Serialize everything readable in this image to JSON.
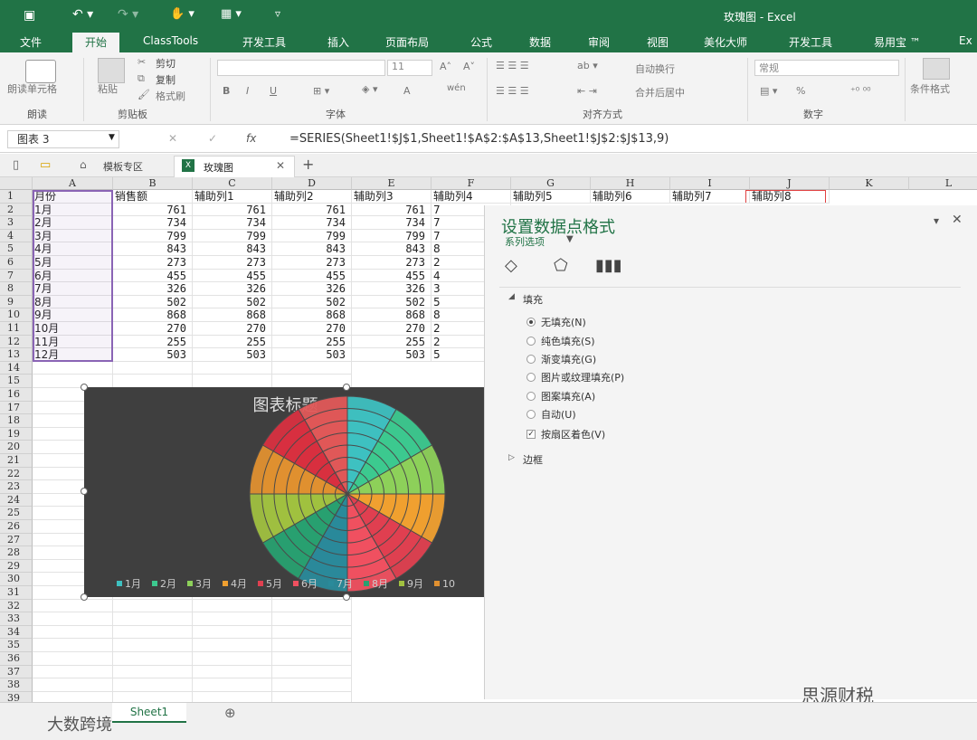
{
  "titlebar": {
    "title": "玫瑰图 - Excel"
  },
  "tabs": [
    "文件",
    "开始",
    "ClassTools",
    "开发工具",
    "插入",
    "页面布局",
    "公式",
    "数据",
    "审阅",
    "视图",
    "美化大师",
    "开发工具",
    "易用宝 ™",
    "Ex"
  ],
  "ribbon": {
    "read_cell": "朗读单元格",
    "paste": "粘贴",
    "cut": "剪切",
    "copy": "复制",
    "format_painter": "格式刷",
    "font_size": "11",
    "bold": "B",
    "italic": "I",
    "underline": "U",
    "font_color": "A",
    "wen": "wén",
    "wrap": "自动换行",
    "merge": "合并后居中",
    "number_format": "常规",
    "percent": "%",
    "cond_format": "条件格式",
    "groups": [
      "朗读",
      "剪贴板",
      "字体",
      "对齐方式",
      "数字"
    ]
  },
  "formula": {
    "name_box": "图表 3",
    "fx": "fx",
    "cancel": "✕",
    "enter": "✓",
    "content": "=SERIES(Sheet1!$J$1,Sheet1!$A$2:$A$13,Sheet1!$J$2:$J$13,9)"
  },
  "file_tabs": {
    "templates": "模板专区",
    "workbook": "玫瑰图",
    "close": "✕",
    "add": "+"
  },
  "columns": [
    "A",
    "B",
    "C",
    "D",
    "E",
    "F",
    "G",
    "H",
    "I",
    "J",
    "K",
    "L"
  ],
  "rows": [
    "1",
    "2",
    "3",
    "4",
    "5",
    "6",
    "7",
    "8",
    "9",
    "10",
    "11",
    "12",
    "13",
    "14",
    "15",
    "16",
    "17",
    "18",
    "19",
    "20",
    "21",
    "22",
    "23",
    "24",
    "25",
    "26",
    "27",
    "28",
    "29",
    "30",
    "31",
    "32",
    "33",
    "34",
    "35",
    "36",
    "37",
    "38",
    "39"
  ],
  "sheet": {
    "headers": [
      "月份",
      "销售额",
      "辅助列1",
      "辅助列2",
      "辅助列3",
      "辅助列4",
      "辅助列5",
      "辅助列6",
      "辅助列7",
      "辅助列8"
    ],
    "months": [
      "1月",
      "2月",
      "3月",
      "4月",
      "5月",
      "6月",
      "7月",
      "8月",
      "9月",
      "10月",
      "11月",
      "12月"
    ],
    "values": [
      "761",
      "734",
      "799",
      "843",
      "273",
      "455",
      "326",
      "502",
      "868",
      "270",
      "255",
      "503"
    ],
    "f_partial": [
      "7",
      "7",
      "7",
      "8",
      "2",
      "4",
      "3",
      "5",
      "8",
      "2",
      "2",
      "5"
    ]
  },
  "chart": {
    "title": "图表标题",
    "legend": [
      "1月",
      "2月",
      "3月",
      "4月",
      "5月",
      "6月",
      "7月",
      "8月",
      "9月",
      "10"
    ],
    "colors": [
      "#3ec0c0",
      "#3cc98f",
      "#8dd05a",
      "#f0a030",
      "#e04050",
      "#f05060",
      "#2a8a9a",
      "#28a070",
      "#a0c040",
      "#e09030",
      "#d83040",
      "#e05858"
    ]
  },
  "panel": {
    "title": "设置数据点格式",
    "series_options": "系列选项",
    "fill": "填充",
    "options": [
      "无填充(N)",
      "纯色填充(S)",
      "渐变填充(G)",
      "图片或纹理填充(P)",
      "图案填充(A)",
      "自动(U)"
    ],
    "vary": "按扇区着色(V)",
    "border": "边框"
  },
  "status": {
    "sheet_tab": "Sheet1",
    "add_sheet": "⊕",
    "watermark_left": "大数跨境",
    "watermark_right": "思源财税"
  }
}
